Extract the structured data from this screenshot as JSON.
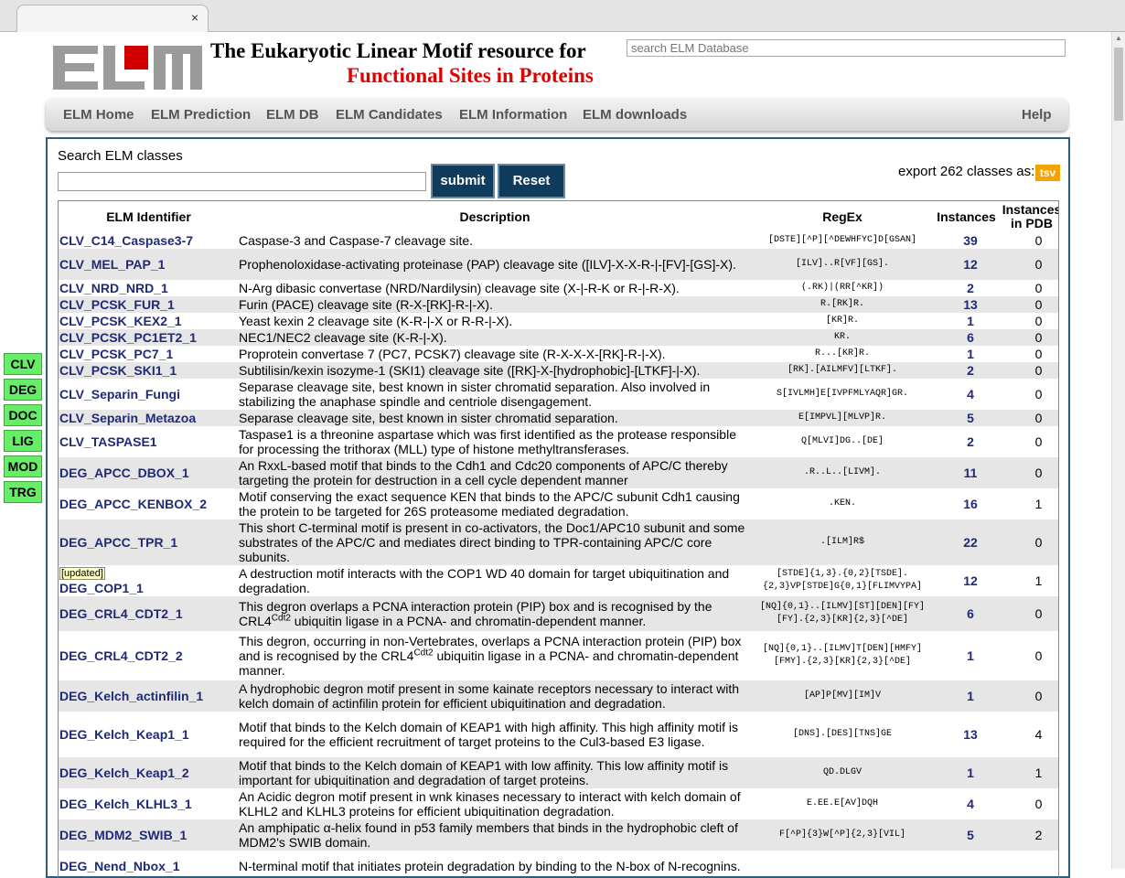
{
  "browser": {
    "tab_close": "×"
  },
  "header": {
    "logo_text": "ELM",
    "title_line1": "The Eukaryotic Linear Motif resource for",
    "title_line2": "Functional Sites in Proteins",
    "search_placeholder": "search ELM Database"
  },
  "nav": {
    "items": [
      "ELM Home",
      "ELM Prediction",
      "ELM DB",
      "ELM Candidates",
      "ELM Information",
      "ELM downloads"
    ],
    "help": "Help"
  },
  "search_panel": {
    "label": "Search ELM classes",
    "input_value": "",
    "submit_label": "submit",
    "reset_label": "Reset",
    "export_text": "export 262 classes as:",
    "tsv_label": "tsv"
  },
  "table": {
    "headers": {
      "id": "ELM Identifier",
      "desc": "Description",
      "regex": "RegEx",
      "instances": "Instances",
      "pdb_line1": "Instances",
      "pdb_line2": "in PDB"
    },
    "rows": [
      {
        "id": "CLV_C14_Caspase3-7",
        "desc": "Caspase-3 and Caspase-7 cleavage site.",
        "regex": "[DSTE][^P][^DEWHFYC]D[GSAN]",
        "instances": "39",
        "pdb": "0"
      },
      {
        "id": "CLV_MEL_PAP_1",
        "desc": "Prophenoloxidase-activating proteinase (PAP) cleavage site ([ILV]-X-X-R-|-[FV]-[GS]-X).",
        "regex": "[ILV]..R[VF][GS].",
        "instances": "12",
        "pdb": "0"
      },
      {
        "id": "CLV_NRD_NRD_1",
        "desc": "N-Arg dibasic convertase (NRD/Nardilysin) cleavage site (X-|-R-K or R-|-R-X).",
        "regex": "(.RK)|(RR[^KR])",
        "instances": "2",
        "pdb": "0"
      },
      {
        "id": "CLV_PCSK_FUR_1",
        "desc": "Furin (PACE) cleavage site (R-X-[RK]-R-|-X).",
        "regex": "R.[RK]R.",
        "instances": "13",
        "pdb": "0"
      },
      {
        "id": "CLV_PCSK_KEX2_1",
        "desc": "Yeast kexin 2 cleavage site (K-R-|-X or R-R-|-X).",
        "regex": "[KR]R.",
        "instances": "1",
        "pdb": "0"
      },
      {
        "id": "CLV_PCSK_PC1ET2_1",
        "desc": "NEC1/NEC2 cleavage site (K-R-|-X).",
        "regex": "KR.",
        "instances": "6",
        "pdb": "0"
      },
      {
        "id": "CLV_PCSK_PC7_1",
        "desc": "Proprotein convertase 7 (PC7, PCSK7) cleavage site (R-X-X-X-[RK]-R-|-X).",
        "regex": "R...[KR]R.",
        "instances": "1",
        "pdb": "0"
      },
      {
        "id": "CLV_PCSK_SKI1_1",
        "desc": "Subtilisin/kexin isozyme-1 (SKI1) cleavage site ([RK]-X-[hydrophobic]-[LTKF]-|-X).",
        "regex": "[RK].[AILMFV][LTKF].",
        "instances": "2",
        "pdb": "0"
      },
      {
        "id": "CLV_Separin_Fungi",
        "desc": "Separase cleavage site, best known in sister chromatid separation. Also involved in stabilizing the anaphase spindle and centriole disengagement.",
        "regex": "S[IVLMH]E[IVPFMLYAQR]GR.",
        "instances": "4",
        "pdb": "0"
      },
      {
        "id": "CLV_Separin_Metazoa",
        "desc": "Separase cleavage site, best known in sister chromatid separation.",
        "regex": "E[IMPVL][MLVP]R.",
        "instances": "5",
        "pdb": "0"
      },
      {
        "id": "CLV_TASPASE1",
        "desc": "Taspase1 is a threonine aspartase which was first identified as the protease responsible for processing the trithorax (MLL) type of histone methyltransferases.",
        "regex": "Q[MLVI]DG..[DE]",
        "instances": "2",
        "pdb": "0"
      },
      {
        "id": "DEG_APCC_DBOX_1",
        "desc": "An RxxL-based motif that binds to the Cdh1 and Cdc20 components of APC/C thereby targeting the protein for destruction in a cell cycle dependent manner",
        "regex": ".R..L..[LIVM].",
        "instances": "11",
        "pdb": "0"
      },
      {
        "id": "DEG_APCC_KENBOX_2",
        "desc": "Motif conserving the exact sequence KEN that binds to the APC/C subunit Cdh1 causing the protein to be targeted for 26S proteasome mediated degradation.",
        "regex": ".KEN.",
        "instances": "16",
        "pdb": "1"
      },
      {
        "id": "DEG_APCC_TPR_1",
        "desc": "This short C-terminal motif is present in co-activators, the Doc1/APC10 subunit and some substrates of the APC/C and mediates direct binding to TPR-containing APC/C core subunits.",
        "regex": ".[ILM]R$",
        "instances": "22",
        "pdb": "0"
      },
      {
        "id": "DEG_COP1_1",
        "badge": "[updated]",
        "desc": "A destruction motif interacts with the COP1 WD 40 domain for target ubiquitination and degradation.",
        "regex": "[STDE]{1,3}.{0,2}[TSDE].{2,3}VP[STDE]G{0,1}[FLIMVYPA]",
        "instances": "12",
        "pdb": "1"
      },
      {
        "id": "DEG_CRL4_CDT2_1",
        "desc_pre": "This degron overlaps a PCNA interaction protein (PIP) box and is recognised by the CRL4",
        "desc_sup": "Cdt2",
        "desc_post": " ubiquitin ligase in a PCNA- and chromatin-dependent manner.",
        "regex": "[NQ]{0,1}..[ILMV][ST][DEN][FY][FY].{2,3}[KR]{2,3}[^DE]",
        "instances": "6",
        "pdb": "0"
      },
      {
        "id": "DEG_CRL4_CDT2_2",
        "desc_pre": "This degron, occurring in non-Vertebrates, overlaps a PCNA interaction protein (PIP) box and is recognised by the CRL4",
        "desc_sup": "Cdt2",
        "desc_post": " ubiquitin ligase in a PCNA- and chromatin-dependent manner.",
        "regex": "[NQ]{0,1}..[ILMV]T[DEN][HMFY][FMY].{2,3}[KR]{2,3}[^DE]",
        "instances": "1",
        "pdb": "0"
      },
      {
        "id": "DEG_Kelch_actinfilin_1",
        "desc": "A hydrophobic degron motif present in some kainate receptors necessary to interact with kelch domain of actinfilin protein for efficient ubiquitination and degradation.",
        "regex": "[AP]P[MV][IM]V",
        "instances": "1",
        "pdb": "0"
      },
      {
        "id": "DEG_Kelch_Keap1_1",
        "desc": "Motif that binds to the Kelch domain of KEAP1 with high affinity. This high affinity motif is required for the efficient recruitment of target proteins to the Cul3-based E3 ligase.",
        "regex": "[DNS].[DES][TNS]GE",
        "instances": "13",
        "pdb": "4"
      },
      {
        "id": "DEG_Kelch_Keap1_2",
        "desc": "Motif that binds to the Kelch domain of KEAP1 with low affinity. This low affinity motif is important for ubiquitination and degradation of target proteins.",
        "regex": "QD.DLGV",
        "instances": "1",
        "pdb": "1"
      },
      {
        "id": "DEG_Kelch_KLHL3_1",
        "desc": "An Acidic degron motif present in wnk kinases necessary to interact with kelch domain of KLHL2 and KLHL3 proteins for efficient ubiquitination degradation.",
        "regex": "E.EE.E[AV]DQH",
        "instances": "4",
        "pdb": "0"
      },
      {
        "id": "DEG_MDM2_SWIB_1",
        "desc": "An amphipatic α-helix found in p53 family members that binds in the hydrophobic cleft of MDM2's SWIB domain.",
        "regex": "F[^P]{3}W[^P]{2,3}[VIL]",
        "instances": "5",
        "pdb": "2"
      },
      {
        "id": "DEG_Nend_Nbox_1",
        "desc": "N-terminal motif that initiates protein degradation by binding to the N-box of N-recognins.",
        "regex": "",
        "instances": "",
        "pdb": ""
      }
    ]
  },
  "sidebar": {
    "items": [
      "CLV",
      "DEG",
      "DOC",
      "LIG",
      "MOD",
      "TRG"
    ]
  }
}
